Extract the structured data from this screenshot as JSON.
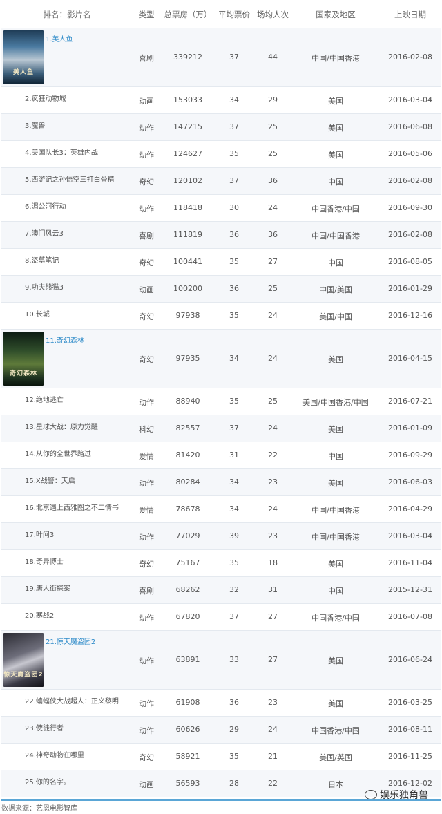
{
  "header": {
    "name": "排名：影片名",
    "type": "类型",
    "box": "总票房（万）",
    "price": "平均票价",
    "audience": "场均人次",
    "region": "国家及地区",
    "date": "上映日期"
  },
  "rows": [
    {
      "title": "1.美人鱼",
      "type": "喜剧",
      "box": "339212",
      "price": "37",
      "audience": "44",
      "region": "中国/中国香港",
      "date": "2016-02-08",
      "poster": "美人鱼"
    },
    {
      "title": "2.疯狂动物城",
      "type": "动画",
      "box": "153033",
      "price": "34",
      "audience": "29",
      "region": "美国",
      "date": "2016-03-04"
    },
    {
      "title": "3.魔兽",
      "type": "动作",
      "box": "147215",
      "price": "37",
      "audience": "25",
      "region": "美国",
      "date": "2016-06-08"
    },
    {
      "title": "4.美国队长3：英雄内战",
      "type": "动作",
      "box": "124627",
      "price": "35",
      "audience": "25",
      "region": "美国",
      "date": "2016-05-06"
    },
    {
      "title": "5.西游记之孙悟空三打白骨精",
      "type": "奇幻",
      "box": "120102",
      "price": "37",
      "audience": "36",
      "region": "中国",
      "date": "2016-02-08"
    },
    {
      "title": "6.湄公河行动",
      "type": "动作",
      "box": "118418",
      "price": "30",
      "audience": "24",
      "region": "中国香港/中国",
      "date": "2016-09-30"
    },
    {
      "title": "7.澳门风云3",
      "type": "喜剧",
      "box": "111819",
      "price": "36",
      "audience": "36",
      "region": "中国/中国香港",
      "date": "2016-02-08"
    },
    {
      "title": "8.盗墓笔记",
      "type": "奇幻",
      "box": "100441",
      "price": "35",
      "audience": "27",
      "region": "中国",
      "date": "2016-08-05"
    },
    {
      "title": "9.功夫熊猫3",
      "type": "动画",
      "box": "100200",
      "price": "36",
      "audience": "25",
      "region": "中国/美国",
      "date": "2016-01-29"
    },
    {
      "title": "10.长城",
      "type": "奇幻",
      "box": "97938",
      "price": "35",
      "audience": "24",
      "region": "美国/中国",
      "date": "2016-12-16"
    },
    {
      "title": "11.奇幻森林",
      "type": "奇幻",
      "box": "97935",
      "price": "34",
      "audience": "24",
      "region": "美国",
      "date": "2016-04-15",
      "poster": "奇幻森林"
    },
    {
      "title": "12.绝地逃亡",
      "type": "动作",
      "box": "88940",
      "price": "35",
      "audience": "25",
      "region": "美国/中国香港/中国",
      "date": "2016-07-21"
    },
    {
      "title": "13.星球大战：原力觉醒",
      "type": "科幻",
      "box": "82557",
      "price": "37",
      "audience": "24",
      "region": "美国",
      "date": "2016-01-09"
    },
    {
      "title": "14.从你的全世界路过",
      "type": "爱情",
      "box": "81420",
      "price": "31",
      "audience": "22",
      "region": "中国",
      "date": "2016-09-29"
    },
    {
      "title": "15.X战警：天启",
      "type": "动作",
      "box": "80284",
      "price": "34",
      "audience": "23",
      "region": "美国",
      "date": "2016-06-03"
    },
    {
      "title": "16.北京遇上西雅图之不二情书",
      "type": "爱情",
      "box": "78678",
      "price": "34",
      "audience": "24",
      "region": "中国/中国香港",
      "date": "2016-04-29"
    },
    {
      "title": "17.叶问3",
      "type": "动作",
      "box": "77029",
      "price": "39",
      "audience": "23",
      "region": "中国/中国香港",
      "date": "2016-03-04"
    },
    {
      "title": "18.奇异博士",
      "type": "奇幻",
      "box": "75167",
      "price": "35",
      "audience": "18",
      "region": "美国",
      "date": "2016-11-04"
    },
    {
      "title": "19.唐人街探案",
      "type": "喜剧",
      "box": "68262",
      "price": "32",
      "audience": "31",
      "region": "中国",
      "date": "2015-12-31"
    },
    {
      "title": "20.寒战2",
      "type": "动作",
      "box": "67820",
      "price": "37",
      "audience": "27",
      "region": "中国香港/中国",
      "date": "2016-07-08"
    },
    {
      "title": "21.惊天魔盗团2",
      "type": "动作",
      "box": "63891",
      "price": "33",
      "audience": "27",
      "region": "美国",
      "date": "2016-06-24",
      "poster": "惊天魔盗团2"
    },
    {
      "title": "22.蝙蝠侠大战超人：正义黎明",
      "type": "动作",
      "box": "61908",
      "price": "36",
      "audience": "23",
      "region": "美国",
      "date": "2016-03-25"
    },
    {
      "title": "23.使徒行者",
      "type": "动作",
      "box": "60626",
      "price": "29",
      "audience": "24",
      "region": "中国香港/中国",
      "date": "2016-08-11"
    },
    {
      "title": "24.神奇动物在哪里",
      "type": "奇幻",
      "box": "58921",
      "price": "35",
      "audience": "21",
      "region": "美国/英国",
      "date": "2016-11-25"
    },
    {
      "title": "25.你的名字。",
      "type": "动画",
      "box": "56593",
      "price": "28",
      "audience": "22",
      "region": "日本",
      "date": "2016-12-02"
    }
  ],
  "footer": {
    "source": "数据来源：艺恩电影智库",
    "watermark": "娱乐独角兽"
  }
}
